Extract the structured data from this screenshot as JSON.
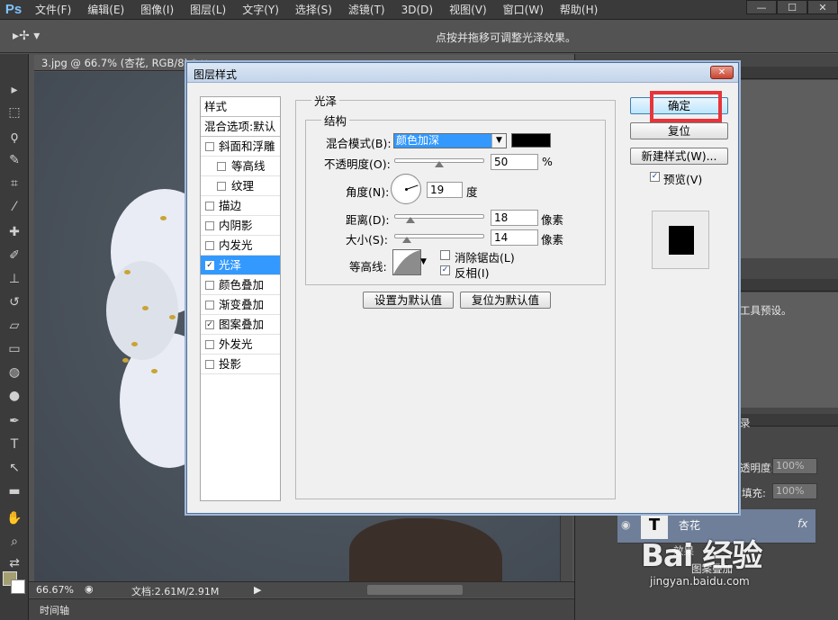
{
  "app": {
    "logo": "Ps",
    "menu": [
      "文件(F)",
      "编辑(E)",
      "图像(I)",
      "图层(L)",
      "文字(Y)",
      "选择(S)",
      "滤镜(T)",
      "3D(D)",
      "视图(V)",
      "窗口(W)",
      "帮助(H)"
    ],
    "window_controls": [
      "—",
      "☐",
      "✕"
    ]
  },
  "options_bar": {
    "tool_icon": "move-tool-icon",
    "hint": "点按并拖移可调整光泽效果。"
  },
  "document": {
    "tab": "3.jpg @ 66.7% (杏花, RGB/8) * ✕",
    "zoom": "66.67%",
    "doc_size": "文档:2.61M/2.91M"
  },
  "timeline": {
    "label": "时间轴"
  },
  "right_panel": {
    "tool_presets_hint": "工具预设。",
    "layers_tab": "录",
    "opacity_label": "透明度:",
    "opacity_value": "100%",
    "fill_label": "填充:",
    "fill_value": "100%",
    "layer_name": "杏花",
    "effects_label": "效果",
    "effect_pattern": "图案叠加",
    "fx": "fx"
  },
  "dialog": {
    "title": "图层样式",
    "close": "✕",
    "styles_header": "样式",
    "blend_default": "混合选项:默认",
    "styles": [
      {
        "label": "斜面和浮雕",
        "checked": false,
        "indent": false
      },
      {
        "label": "等高线",
        "checked": false,
        "indent": true
      },
      {
        "label": "纹理",
        "checked": false,
        "indent": true
      },
      {
        "label": "描边",
        "checked": false,
        "indent": false
      },
      {
        "label": "内阴影",
        "checked": false,
        "indent": false
      },
      {
        "label": "内发光",
        "checked": false,
        "indent": false
      },
      {
        "label": "光泽",
        "checked": true,
        "indent": false,
        "selected": true
      },
      {
        "label": "颜色叠加",
        "checked": false,
        "indent": false
      },
      {
        "label": "渐变叠加",
        "checked": false,
        "indent": false
      },
      {
        "label": "图案叠加",
        "checked": true,
        "indent": false
      },
      {
        "label": "外发光",
        "checked": false,
        "indent": false
      },
      {
        "label": "投影",
        "checked": false,
        "indent": false
      }
    ],
    "satin": {
      "group_title": "光泽",
      "structure_title": "结构",
      "blend_mode_label": "混合模式(B):",
      "blend_mode_value": "颜色加深",
      "color": "#000000",
      "opacity_label": "不透明度(O):",
      "opacity_value": "50",
      "opacity_unit": "%",
      "angle_label": "角度(N):",
      "angle_value": "19",
      "angle_unit": "度",
      "distance_label": "距离(D):",
      "distance_value": "18",
      "distance_unit": "像素",
      "size_label": "大小(S):",
      "size_value": "14",
      "size_unit": "像素",
      "contour_label": "等高线:",
      "antialias_label": "消除锯齿(L)",
      "antialias_checked": false,
      "invert_label": "反相(I)",
      "invert_checked": true,
      "set_default": "设置为默认值",
      "reset_default": "复位为默认值",
      "slider_fraction": {
        "opacity": 0.5,
        "distance": 0.18,
        "size": 0.14
      }
    },
    "buttons": {
      "ok": "确定",
      "reset": "复位",
      "new_style": "新建样式(W)...",
      "preview_label": "预览(V)",
      "preview_checked": true
    },
    "highlight_color": "#e8343a"
  },
  "watermark": {
    "main": "Bai 经验",
    "sub": "jingyan.baidu.com"
  }
}
